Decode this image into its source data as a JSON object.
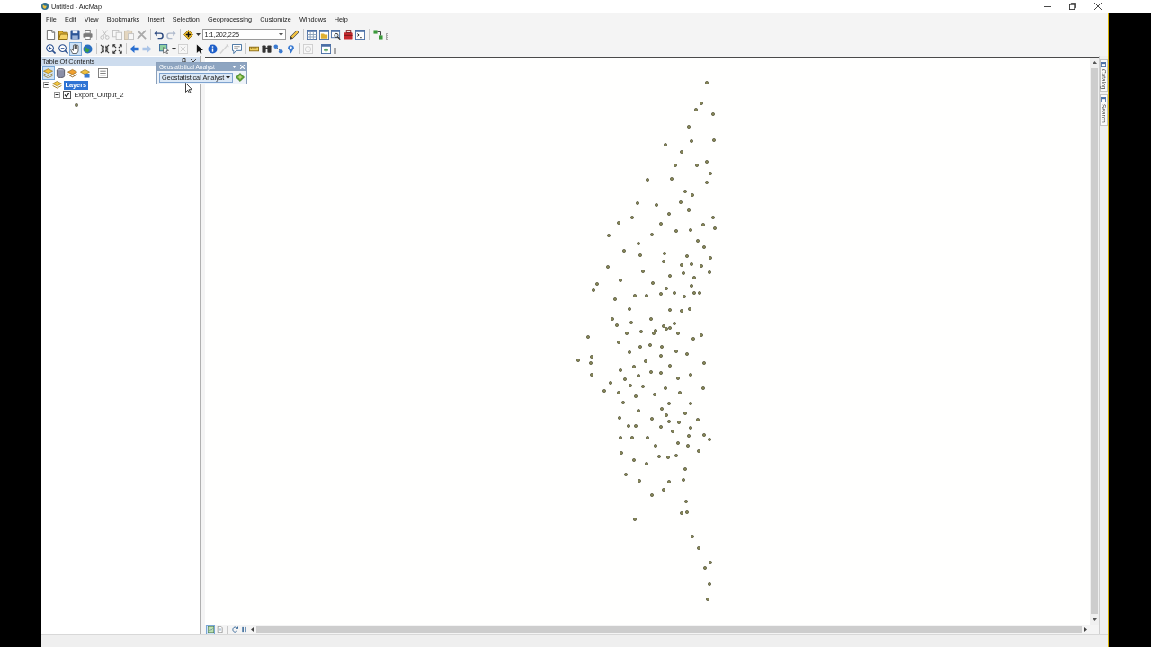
{
  "window": {
    "title": "Untitled - ArcMap"
  },
  "menu_bar": [
    "File",
    "Edit",
    "View",
    "Bookmarks",
    "Insert",
    "Selection",
    "Geoprocessing",
    "Customize",
    "Windows",
    "Help"
  ],
  "standard_toolbar": [
    [
      {
        "kind": "new",
        "disabled": false
      },
      {
        "kind": "open",
        "disabled": false
      },
      {
        "kind": "save",
        "disabled": false
      },
      {
        "kind": "print",
        "disabled": false
      }
    ],
    [
      {
        "kind": "cut",
        "disabled": true
      },
      {
        "kind": "copy",
        "disabled": true
      },
      {
        "kind": "paste",
        "disabled": true
      },
      {
        "kind": "delete",
        "disabled": true
      }
    ],
    [
      {
        "kind": "undo",
        "disabled": false
      },
      {
        "kind": "redo",
        "disabled": true
      }
    ],
    [
      {
        "kind": "add_data",
        "disabled": false
      },
      {
        "kind": "caret",
        "disabled": false
      },
      {
        "kind": "scale",
        "value": "1:1,202,225",
        "disabled": false
      },
      {
        "kind": "editor",
        "disabled": false
      }
    ],
    [
      {
        "kind": "table",
        "disabled": false
      },
      {
        "kind": "catalog",
        "disabled": false
      },
      {
        "kind": "search",
        "disabled": false
      },
      {
        "kind": "toolbox",
        "disabled": false
      },
      {
        "kind": "python",
        "disabled": false
      }
    ],
    [
      {
        "kind": "model",
        "disabled": false
      }
    ]
  ],
  "tools_toolbar": [
    [
      {
        "kind": "zoom_in",
        "selected": false,
        "disabled": false
      },
      {
        "kind": "zoom_out",
        "selected": false,
        "disabled": false
      },
      {
        "kind": "pan",
        "selected": true,
        "disabled": false
      },
      {
        "kind": "full_extent",
        "selected": false,
        "disabled": false
      }
    ],
    [
      {
        "kind": "fixed_in",
        "selected": false,
        "disabled": false
      },
      {
        "kind": "fixed_out",
        "selected": false,
        "disabled": false
      }
    ],
    [
      {
        "kind": "back",
        "selected": false,
        "disabled": false
      },
      {
        "kind": "forward",
        "selected": false,
        "disabled": true
      }
    ],
    [
      {
        "kind": "select",
        "selected": false,
        "disabled": false
      },
      {
        "kind": "caret",
        "selected": false,
        "disabled": false
      },
      {
        "kind": "clear",
        "selected": false,
        "disabled": true
      }
    ],
    [
      {
        "kind": "pointer",
        "selected": false,
        "disabled": false
      },
      {
        "kind": "identify",
        "selected": false,
        "disabled": false
      },
      {
        "kind": "pen",
        "selected": false,
        "disabled": true
      },
      {
        "kind": "popup",
        "selected": false,
        "disabled": false
      }
    ],
    [
      {
        "kind": "measure",
        "selected": false,
        "disabled": false
      },
      {
        "kind": "find",
        "selected": false,
        "disabled": false
      },
      {
        "kind": "route",
        "selected": false,
        "disabled": false
      },
      {
        "kind": "xy",
        "selected": false,
        "disabled": false
      }
    ],
    [
      {
        "kind": "time",
        "selected": false,
        "disabled": true
      }
    ],
    [
      {
        "kind": "viewer",
        "selected": false,
        "disabled": false
      }
    ]
  ],
  "table_of_contents": {
    "title": "Table Of Contents",
    "view_buttons": [
      {
        "kind": "drawing_order",
        "selected": true
      },
      {
        "kind": "source",
        "selected": false
      },
      {
        "kind": "visibility",
        "selected": false
      },
      {
        "kind": "selection",
        "selected": false
      }
    ],
    "tree": [
      {
        "label": "Layers",
        "expanded": true,
        "selected": true,
        "children": [
          {
            "label": "Export_Output_2",
            "expanded": true,
            "checked": true,
            "selected": false
          }
        ]
      }
    ]
  },
  "floating_toolbar": {
    "title": "Geostatistical Analyst",
    "menu_button": "Geostatistical Analyst"
  },
  "map_view": {
    "view_buttons": [
      {
        "kind": "data_view",
        "selected": true
      },
      {
        "kind": "layout_view",
        "selected": false
      }
    ]
  },
  "dock_tabs": [
    "Catalog",
    "Search"
  ]
}
